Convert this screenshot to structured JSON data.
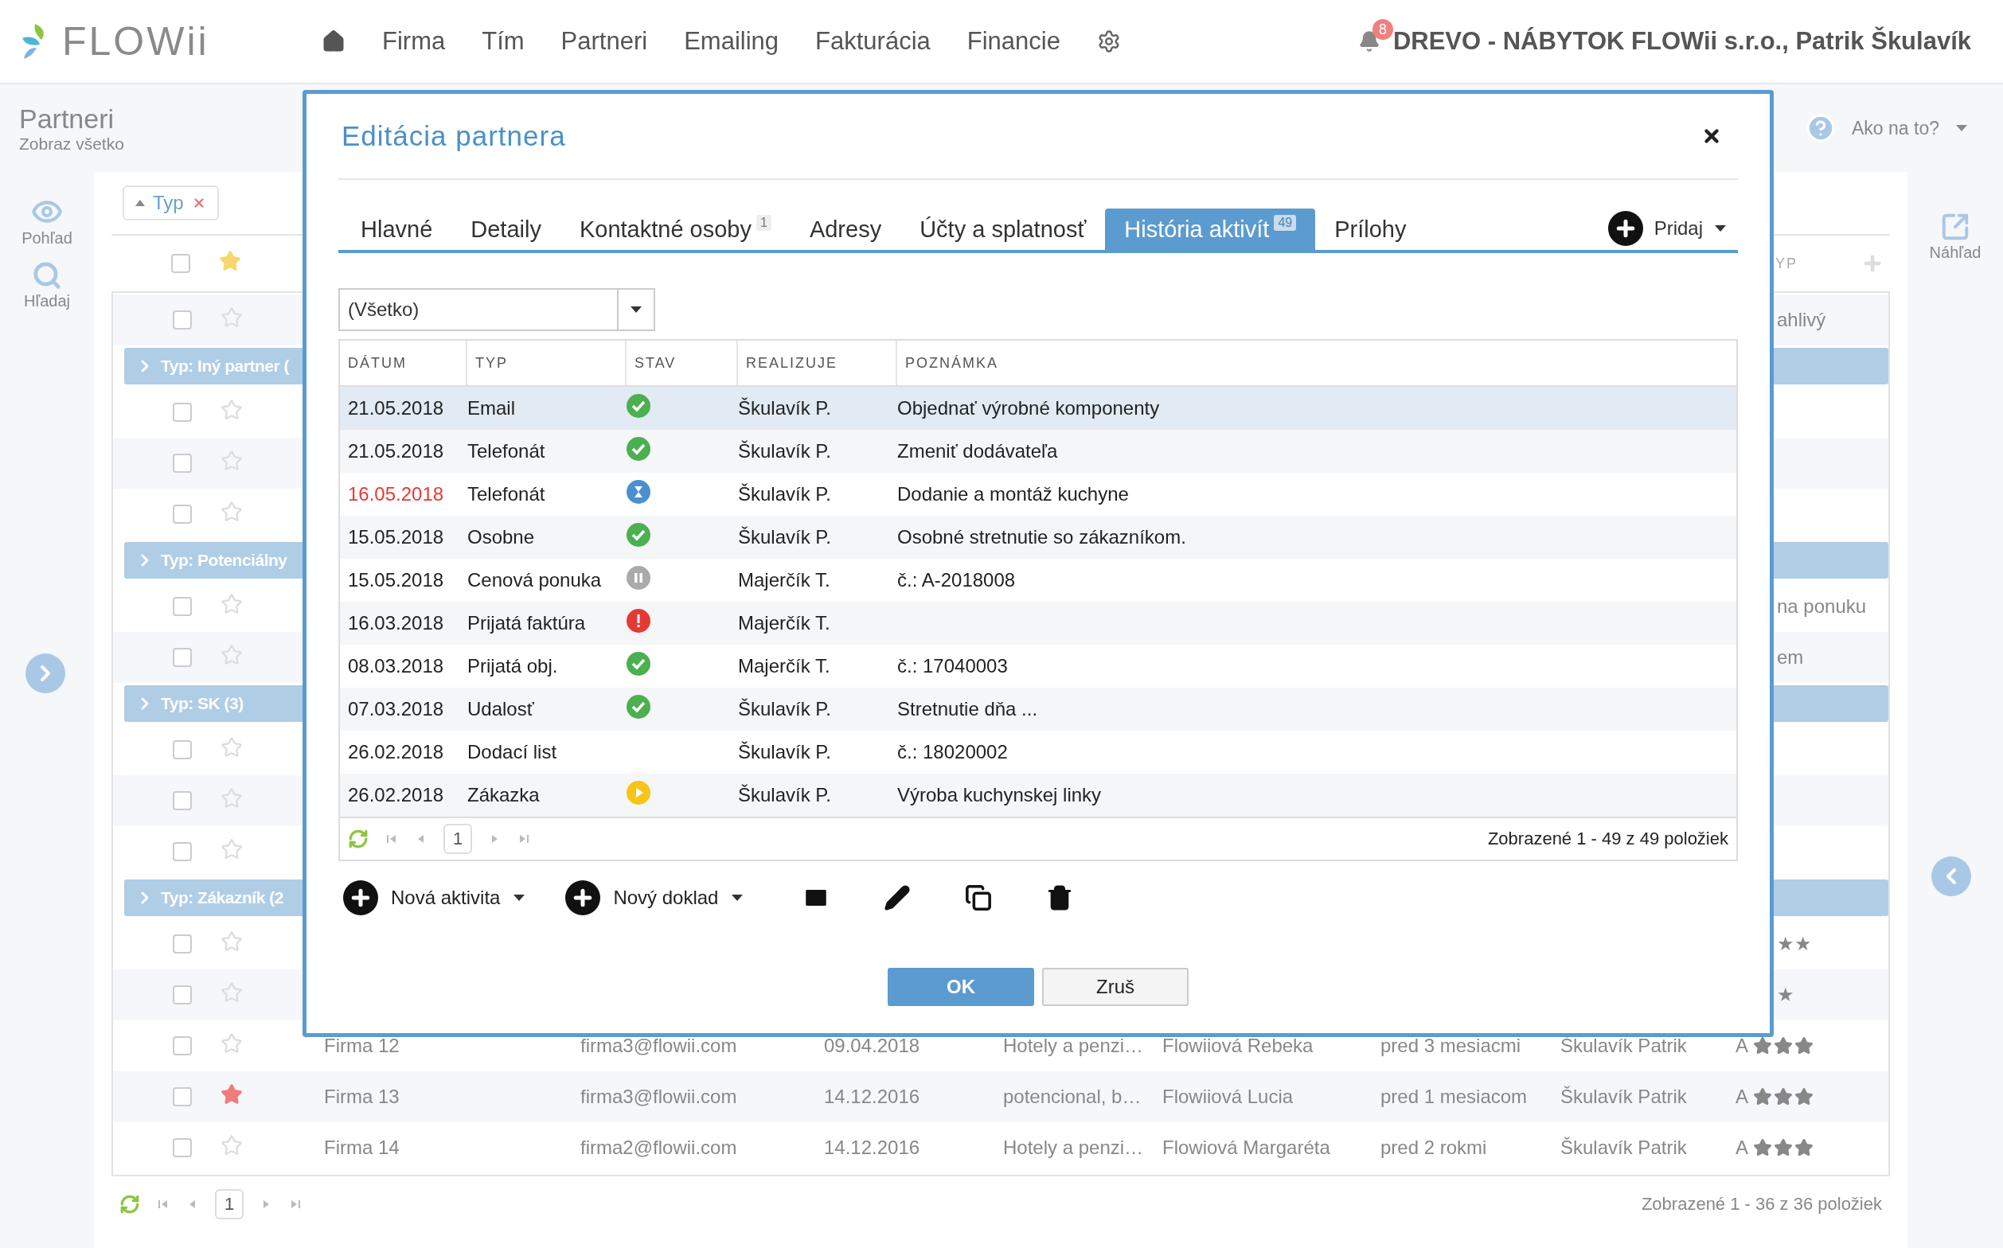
{
  "header": {
    "logo": "FLOWii",
    "nav": [
      {
        "label": "Firma"
      },
      {
        "label": "Tím"
      },
      {
        "label": "Partneri"
      },
      {
        "label": "Emailing"
      },
      {
        "label": "Fakturácia"
      },
      {
        "label": "Financie"
      }
    ],
    "notifications": "8",
    "account": "DREVO - NÁBYTOK FLOWii s.r.o., Patrik Škulavík"
  },
  "page": {
    "title": "Partneri",
    "subtitle": "Zobraz všetko",
    "help": "Ako na to?"
  },
  "left_rail": [
    {
      "kind": "view",
      "label": "Pohľad"
    },
    {
      "kind": "search",
      "label": "Hľadaj"
    }
  ],
  "right_rail": {
    "label": "Náhľad"
  },
  "filter_chip": {
    "label": "Typ"
  },
  "list": {
    "header_tail": "YP",
    "header_checked": false,
    "rows": [
      {
        "kind": "row",
        "checked": false,
        "starred": false,
        "tail": "ahlivý"
      },
      {
        "kind": "group",
        "label": "Typ: Iný partner ("
      },
      {
        "kind": "row",
        "checked": false,
        "starred": false
      },
      {
        "kind": "row",
        "checked": false,
        "starred": false
      },
      {
        "kind": "row",
        "checked": false,
        "starred": false
      },
      {
        "kind": "group",
        "label": "Typ: Potenciálny"
      },
      {
        "kind": "row",
        "checked": false,
        "starred": false,
        "tail": "na ponuku"
      },
      {
        "kind": "row",
        "checked": false,
        "starred": false,
        "tail": "em"
      },
      {
        "kind": "group",
        "label": "Typ: SK (3)"
      },
      {
        "kind": "row",
        "checked": false,
        "starred": false
      },
      {
        "kind": "row",
        "checked": false,
        "starred": false
      },
      {
        "kind": "row",
        "checked": false,
        "starred": false
      },
      {
        "kind": "group",
        "label": "Typ: Zákazník (2"
      },
      {
        "kind": "row",
        "checked": false,
        "starred": false,
        "tail": "★★"
      },
      {
        "kind": "row",
        "checked": false,
        "starred": false,
        "tail": "★"
      },
      {
        "kind": "row",
        "checked": false,
        "starred": false,
        "name": "Firma 12",
        "email": "firma3@flowii.com",
        "date": "09.04.2018",
        "type": "Hotely a penzi…",
        "contact": "Flowiiová Rebeka",
        "time": "pred 3 mesiacmi",
        "owner": "Škulavík Patrik",
        "rating": "A",
        "stars": 3
      },
      {
        "kind": "row",
        "checked": false,
        "starred": true,
        "name": "Firma 13",
        "email": "firma3@flowii.com",
        "date": "14.12.2016",
        "type": "potencional, b…",
        "contact": "Flowiiová Lucia",
        "time": "pred 1 mesiacom",
        "owner": "Škulavík Patrik",
        "rating": "A",
        "stars": 3
      },
      {
        "kind": "row",
        "checked": false,
        "starred": false,
        "name": "Firma 14",
        "email": "firma2@flowii.com",
        "date": "14.12.2016",
        "type": "Hotely a penzi…",
        "contact": "Flowiová Margaréta",
        "time": "pred 2 rokmi",
        "owner": "Škulavík Patrik",
        "rating": "A",
        "stars": 3
      }
    ],
    "pager": {
      "page": "1",
      "summary": "Zobrazené 1 - 36 z 36 položiek"
    }
  },
  "dialog": {
    "title": "Editácia partnera",
    "tabs": [
      {
        "label": "Hlavné",
        "selected": false
      },
      {
        "label": "Detaily",
        "selected": false
      },
      {
        "label": "Kontaktné osoby",
        "badge": "1",
        "selected": false
      },
      {
        "label": "Adresy",
        "selected": false
      },
      {
        "label": "Účty a splatnosť",
        "selected": false
      },
      {
        "label": "História aktivít",
        "badge": "49",
        "selected": true
      },
      {
        "label": "Prílohy",
        "selected": false
      }
    ],
    "add_button": "Pridaj",
    "filter": "(Všetko)",
    "columns": [
      "DÁTUM",
      "TYP",
      "STAV",
      "REALIZUJE",
      "POZNÁMKA"
    ],
    "rows": [
      {
        "date": "21.05.2018",
        "overdue": false,
        "type": "Email",
        "kind": "done",
        "owner": "Škulavík P.",
        "note": "Objednať výrobné komponenty",
        "selected": true
      },
      {
        "date": "21.05.2018",
        "overdue": false,
        "type": "Telefonát",
        "kind": "done",
        "owner": "Škulavík P.",
        "note": "Zmeniť dodávateľa",
        "selected": false
      },
      {
        "date": "16.05.2018",
        "overdue": true,
        "type": "Telefonát",
        "kind": "waiting",
        "owner": "Škulavík P.",
        "note": "Dodanie a montáž kuchyne",
        "selected": false
      },
      {
        "date": "15.05.2018",
        "overdue": false,
        "type": "Osobne",
        "kind": "done",
        "owner": "Škulavík P.",
        "note": "Osobné stretnutie so zákazníkom.",
        "selected": false
      },
      {
        "date": "15.05.2018",
        "overdue": false,
        "type": "Cenová ponuka",
        "kind": "paused",
        "owner": "Majerčík T.",
        "note": "č.: A-2018008",
        "selected": false
      },
      {
        "date": "16.03.2018",
        "overdue": false,
        "type": "Prijatá faktúra",
        "kind": "error",
        "owner": "Majerčík T.",
        "selected": false
      },
      {
        "date": "08.03.2018",
        "overdue": false,
        "type": "Prijatá obj.",
        "kind": "done",
        "owner": "Majerčík T.",
        "note": "č.: 17040003",
        "selected": false
      },
      {
        "date": "07.03.2018",
        "overdue": false,
        "type": "Udalosť",
        "kind": "done",
        "owner": "Škulavík P.",
        "note": "Stretnutie dňa ...",
        "selected": false
      },
      {
        "date": "26.02.2018",
        "overdue": false,
        "type": "Dodací list",
        "kind": "none",
        "owner": "Škulavík P.",
        "note": "č.: 18020002",
        "selected": false
      },
      {
        "date": "26.02.2018",
        "overdue": false,
        "type": "Zákazka",
        "kind": "running",
        "owner": "Škulavík P.",
        "note": "Výroba kuchynskej linky",
        "selected": false
      }
    ],
    "pager": {
      "page": "1",
      "summary": "Zobrazené 1 - 49 z 49 položiek"
    },
    "actions": [
      {
        "label": "Nová aktivita"
      },
      {
        "label": "Nový doklad"
      }
    ],
    "ok": "OK",
    "cancel": "Zruš"
  }
}
